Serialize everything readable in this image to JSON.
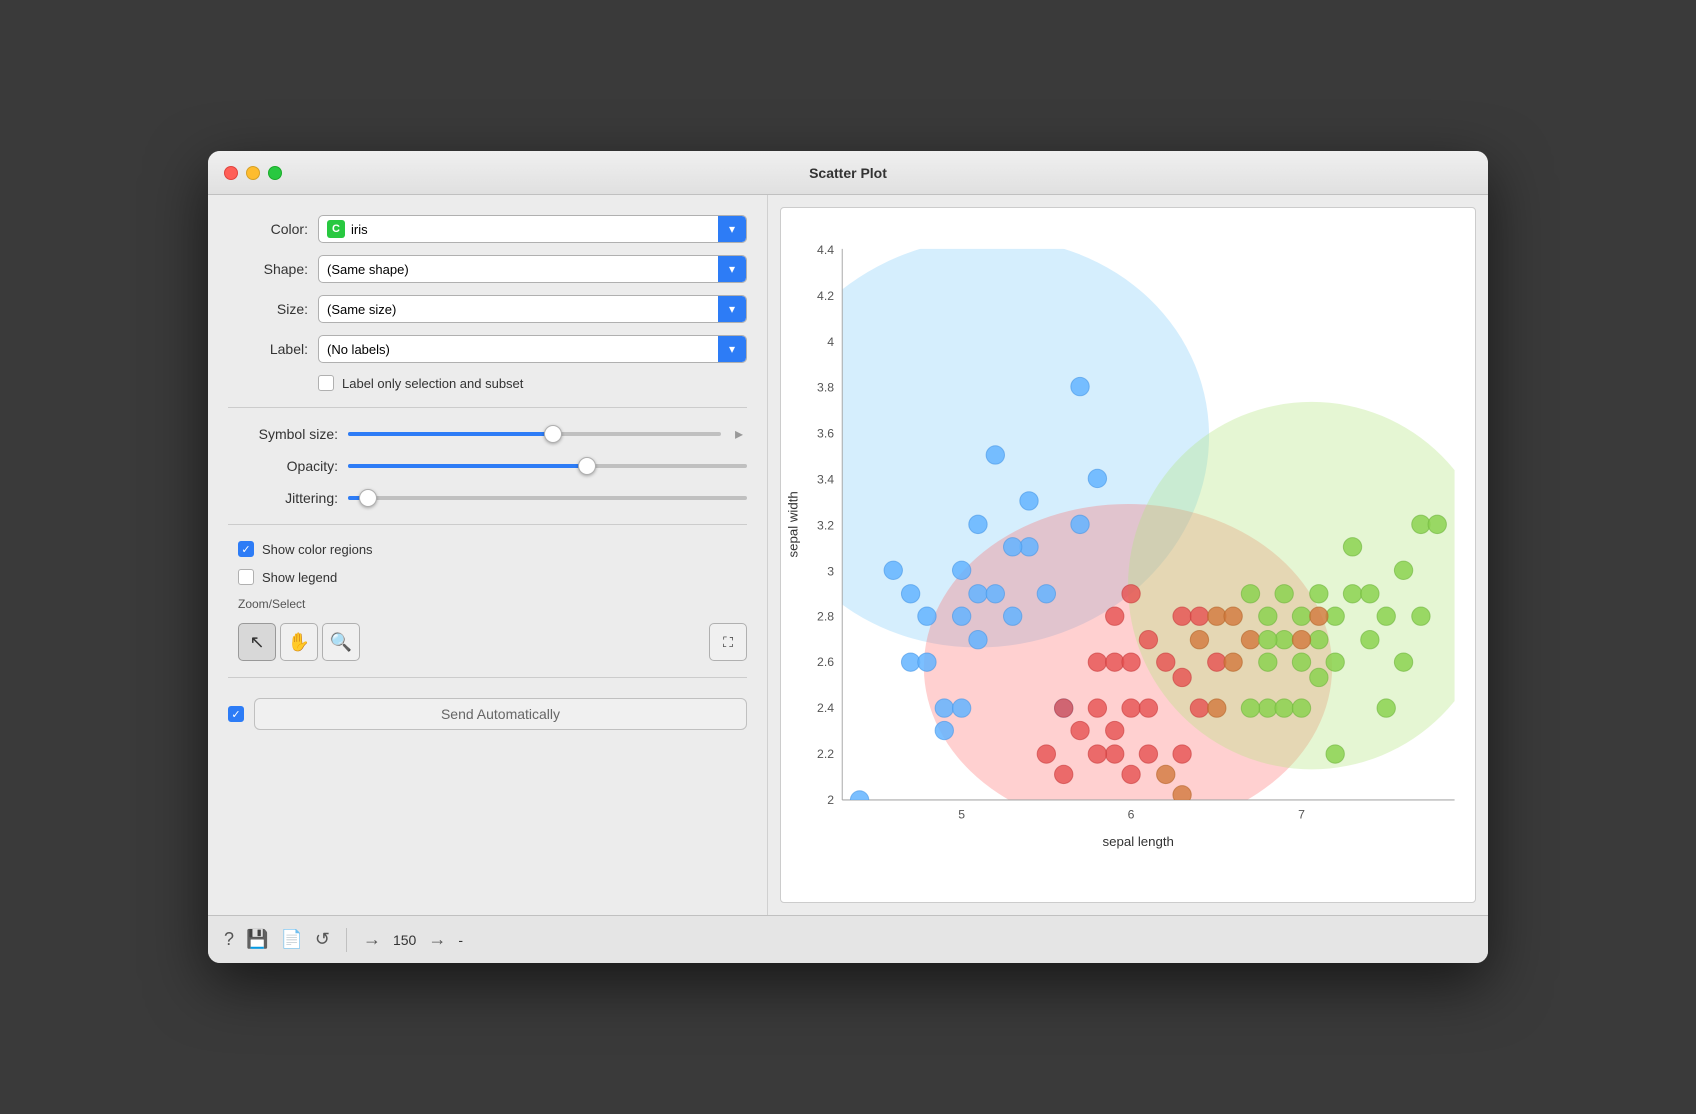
{
  "window": {
    "title": "Scatter Plot"
  },
  "controls": {
    "color_label": "Color:",
    "color_value": "iris",
    "shape_label": "Shape:",
    "shape_value": "(Same shape)",
    "size_label": "Size:",
    "size_value": "(Same size)",
    "label_label": "Label:",
    "label_value": "(No labels)",
    "label_only_checkbox": "Label only selection and subset",
    "symbol_size_label": "Symbol size:",
    "opacity_label": "Opacity:",
    "jittering_label": "Jittering:",
    "symbol_size_pct": 55,
    "opacity_pct": 60,
    "jittering_pct": 5,
    "show_color_regions": "Show color regions",
    "show_legend": "Show legend",
    "zoom_select_label": "Zoom/Select",
    "send_automatically": "Send Automatically",
    "input_count": "150",
    "arrow_icon": "▸"
  },
  "toolbar": {
    "help_icon": "?",
    "save_icon": "💾",
    "doc_icon": "📄",
    "refresh_icon": "↺",
    "input_arrow": "→",
    "output_arrow": "→"
  },
  "chart": {
    "x_label": "sepal length",
    "y_label": "sepal width",
    "x_min": 4.3,
    "x_max": 7.9,
    "y_min": 2.0,
    "y_max": 4.4,
    "x_ticks": [
      5,
      6,
      7
    ],
    "y_ticks": [
      2,
      2.2,
      2.4,
      2.6,
      2.8,
      3,
      3.2,
      3.4,
      3.6,
      3.8,
      4,
      4.2,
      4.4
    ]
  }
}
